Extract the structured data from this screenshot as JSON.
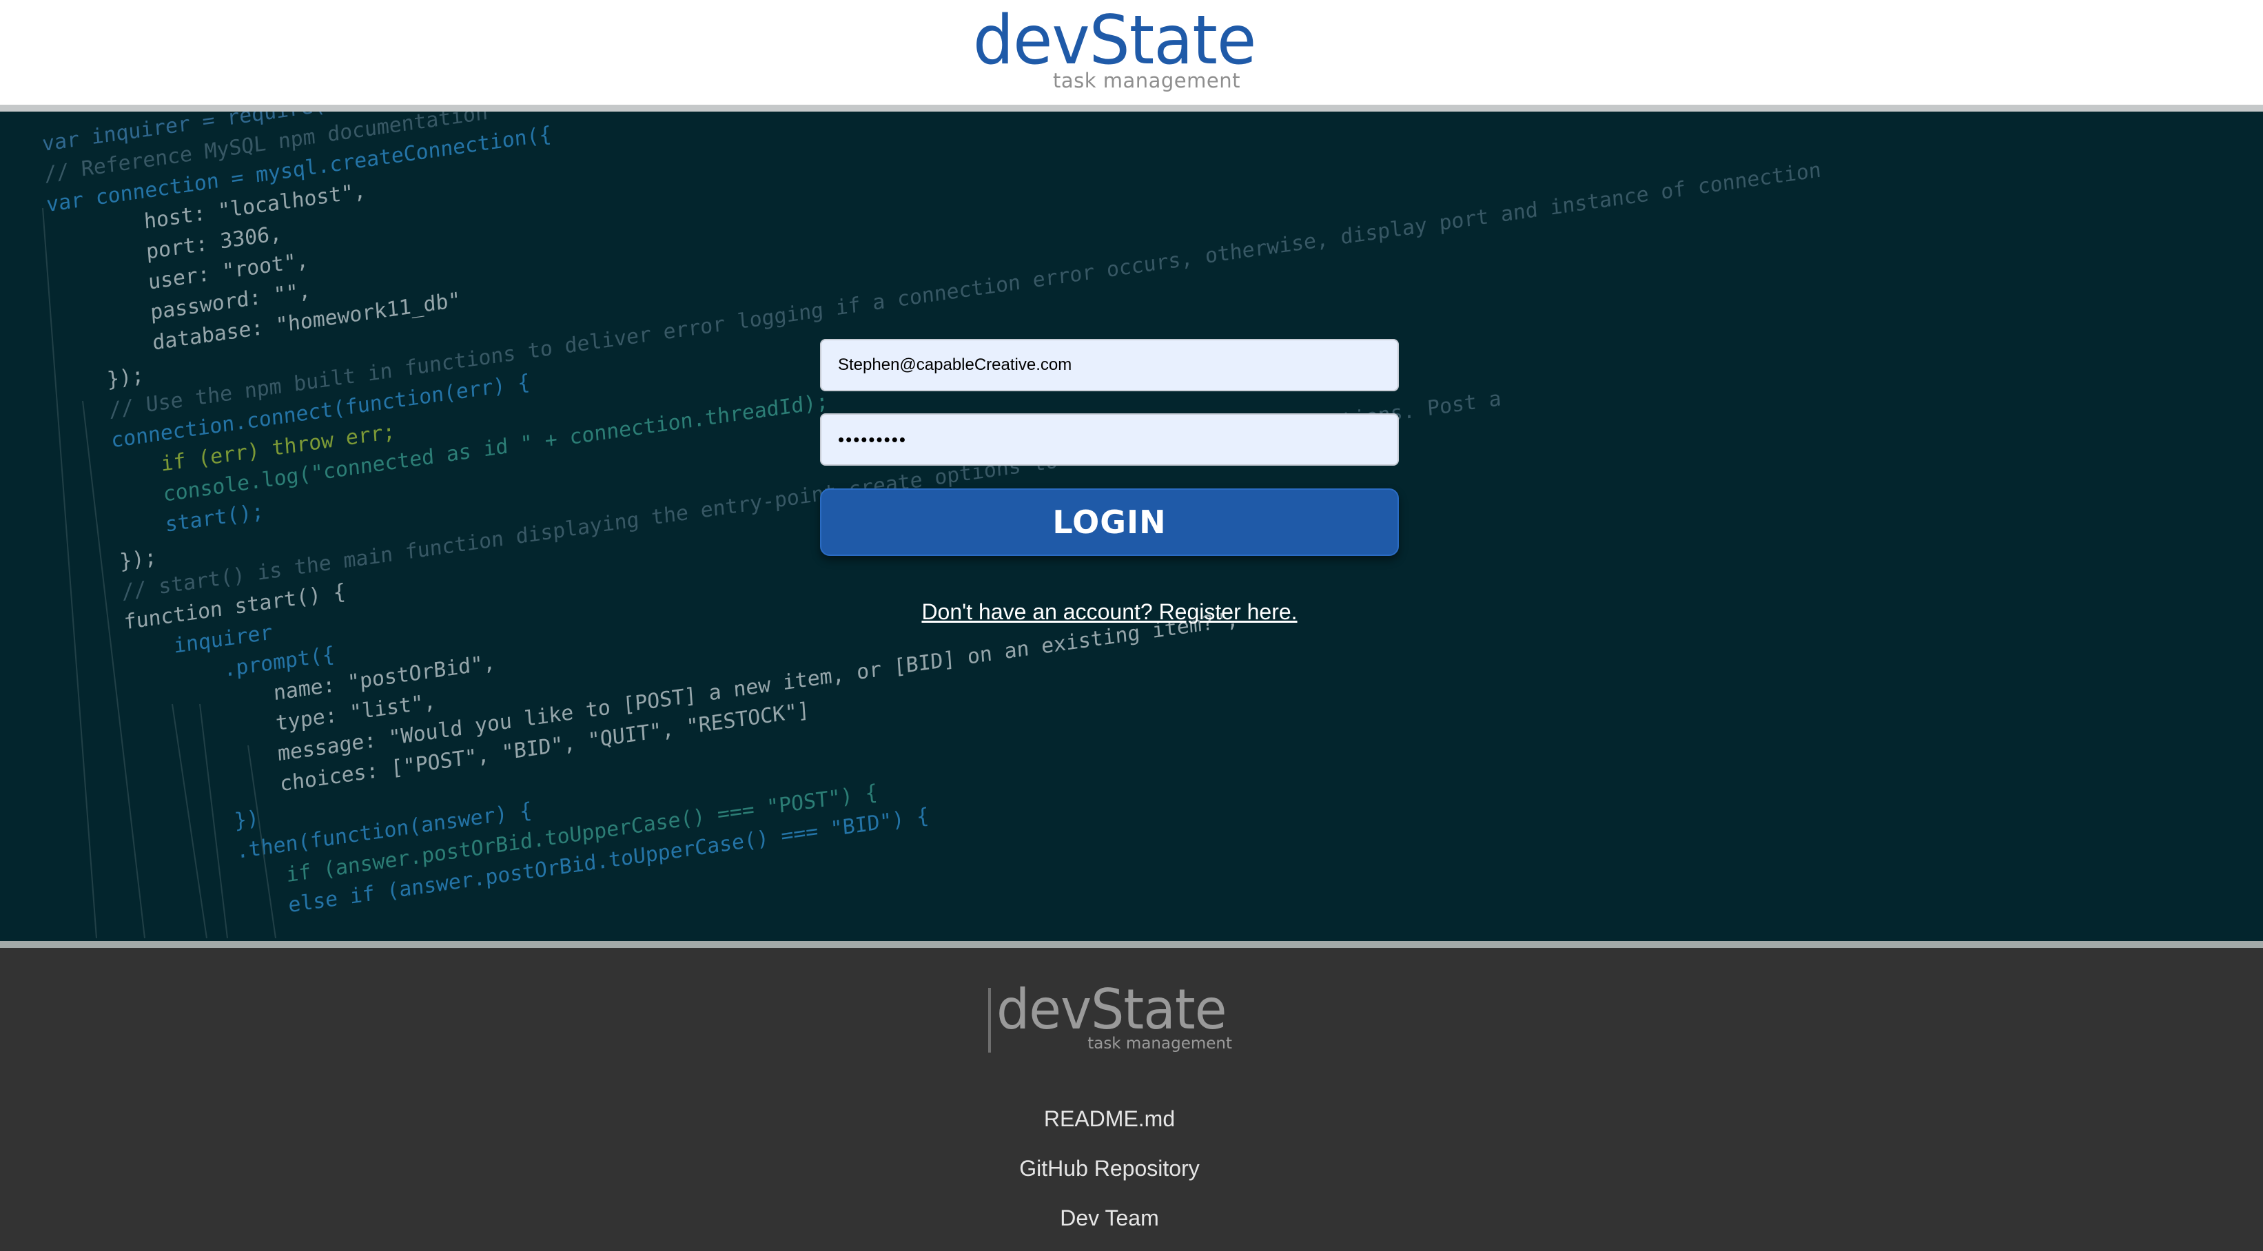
{
  "brand": {
    "name": "devState",
    "tagline": "task management"
  },
  "login_form": {
    "email_value": "Stephen@capableCreative.com",
    "password_value": "•••••••••",
    "login_label": "LOGIN",
    "register_link": "Don't have an account? Register here."
  },
  "footer": {
    "brand_name": "devState",
    "brand_tagline": "task management",
    "links": [
      "README.md",
      "GitHub Repository",
      "Dev Team"
    ]
  },
  "colors": {
    "brand_blue": "#1f5aa8",
    "hero_background": "#03252d",
    "footer_background": "#333333",
    "input_background": "#e8f0fe"
  },
  "background_code_lines": [
    "var inquirer = require(\"inquirer\");",
    "// Reference MySQL npm documentation",
    "var connection = mysql.createConnection({",
    "host: \"localhost\",",
    "port: 3306,",
    "user: \"root\",",
    "password: \"\",",
    "database: \"homework11_db\"",
    "});",
    "// Use the npm built in functions to deliver error logging if a connection error occurs, otherwise, display port and instance of connection",
    "connection.connect(function(err) {",
    "if (err) throw err;",
    "console.log(\"connected as id \" + connection.threadId);",
    "start();",
    "});",
    "// start() is the main function displaying the entry-point create options to lead into our other options. Post a",
    "function start() {",
    "inquirer",
    ".prompt({",
    "name: \"postOrBid\",",
    "type: \"list\",",
    "message: \"Would you like to [POST] a new item, or [BID] on an existing item?\",",
    "choices: [\"POST\", \"BID\", \"QUIT\", \"RESTOCK\"]",
    "})",
    ".then(function(answer) {",
    "if (answer.postOrBid.toUpperCase() === \"POST\") {",
    "else if (answer.postOrBid.toUpperCase() === \"BID\") {"
  ]
}
